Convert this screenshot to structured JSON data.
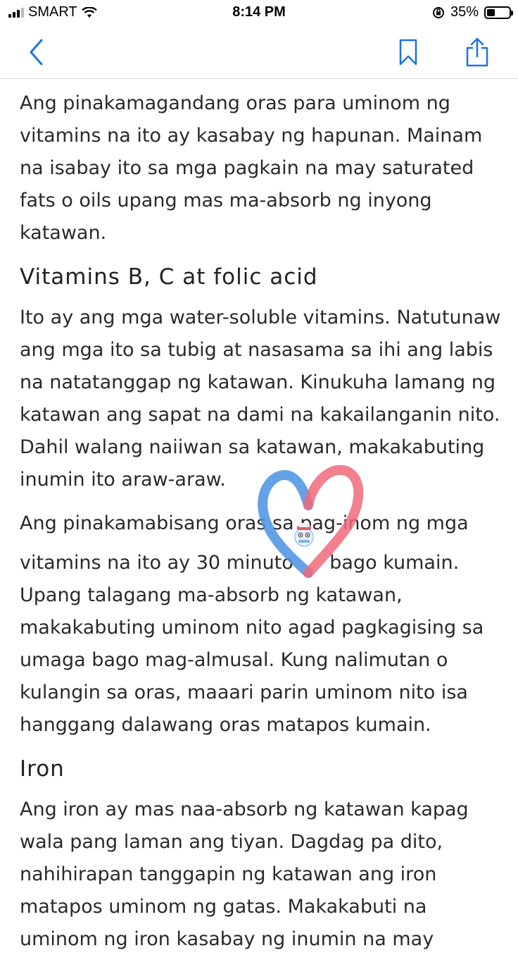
{
  "status_bar": {
    "carrier": "SMART",
    "time": "8:14 PM",
    "battery_percent": "35%",
    "battery_level": 0.35
  },
  "nav": {
    "back_icon": "chevron-left-icon",
    "bookmark_icon": "bookmark-icon",
    "share_icon": "share-icon",
    "accent_color": "#1a73e8"
  },
  "article": {
    "p1": "Ang pinakamagandang oras para uminom ng vitamins na ito ay kasabay ng hapunan. Mainam na isabay ito sa mga pagkain na may saturated fats o oils upang mas ma-absorb ng inyong katawan.",
    "h_b_c": "Vitamins B, C at folic acid",
    "p2": "Ito ay ang mga water-soluble vitamins. Natutunaw ang mga ito sa tubig at nasasama sa ihi ang labis na natatanggap ng katawan. Kinukuha lamang ng katawan ang sapat na dami na kakailanganin nito. Dahil walang naiiwan sa katawan, makakabuting inumin ito araw-araw.",
    "p3_line1": "Ang pinakamabisang oras sa pag-inom ng mga",
    "p3_line2": "vitamins na ito ay 30 minuto      bago kumain.",
    "p3_rest": "Upang talagang ma-absorb ng katawan, makakabuting uminom nito agad pagkagising sa umaga bago mag-almusal. Kung nalimutan o kulangin sa oras, maaari parin uminom nito isa hanggang dalawang oras matapos kumain.",
    "h_iron": "Iron",
    "p4": "Ang iron ay mas naa-absorb ng katawan kapag wala pang laman ang tiyan. Dagdag pa dito, nahihirapan tanggapin ng katawan ang iron matapos uminom ng gatas. Makakabuti na uminom ng iron kasabay ng inumin na may"
  },
  "overlay": {
    "heart_left_color": "#4a90e2",
    "heart_right_color": "#f06a7a"
  }
}
